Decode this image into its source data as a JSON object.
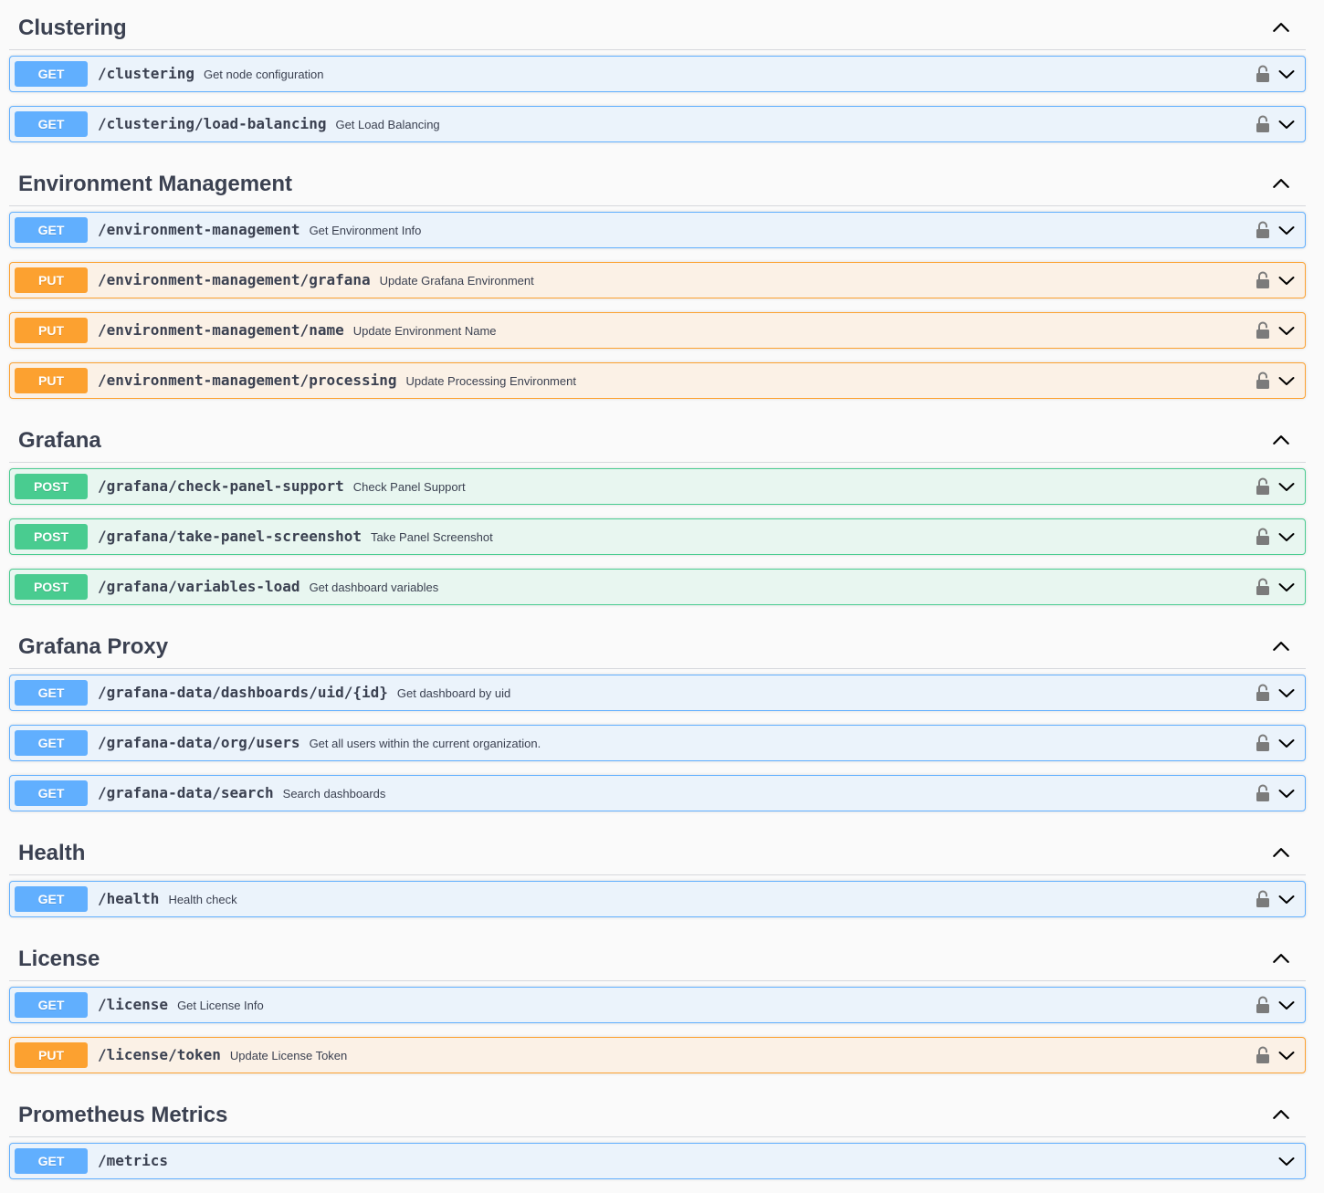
{
  "colors": {
    "get": {
      "badge": "#61affe",
      "bg": "#ebf3fb",
      "border": "#61affe"
    },
    "put": {
      "badge": "#fca130",
      "bg": "#fbf1e6",
      "border": "#fca130"
    },
    "post": {
      "badge": "#49cc90",
      "bg": "#e8f6f0",
      "border": "#49cc90"
    }
  },
  "icons": {
    "section_toggle": "chevron-up-icon",
    "operation_expand": "chevron-down-icon",
    "auth": "lock-icon"
  },
  "sections": [
    {
      "title": "Clustering",
      "operations": [
        {
          "method": "GET",
          "path": "/clustering",
          "summary": "Get node configuration",
          "locked": true
        },
        {
          "method": "GET",
          "path": "/clustering/load-balancing",
          "summary": "Get Load Balancing",
          "locked": true
        }
      ]
    },
    {
      "title": "Environment Management",
      "operations": [
        {
          "method": "GET",
          "path": "/environment-management",
          "summary": "Get Environment Info",
          "locked": true
        },
        {
          "method": "PUT",
          "path": "/environment-management/grafana",
          "summary": "Update Grafana Environment",
          "locked": true
        },
        {
          "method": "PUT",
          "path": "/environment-management/name",
          "summary": "Update Environment Name",
          "locked": true
        },
        {
          "method": "PUT",
          "path": "/environment-management/processing",
          "summary": "Update Processing Environment",
          "locked": true
        }
      ]
    },
    {
      "title": "Grafana",
      "operations": [
        {
          "method": "POST",
          "path": "/grafana/check-panel-support",
          "summary": "Check Panel Support",
          "locked": true
        },
        {
          "method": "POST",
          "path": "/grafana/take-panel-screenshot",
          "summary": "Take Panel Screenshot",
          "locked": true
        },
        {
          "method": "POST",
          "path": "/grafana/variables-load",
          "summary": "Get dashboard variables",
          "locked": true
        }
      ]
    },
    {
      "title": "Grafana Proxy",
      "operations": [
        {
          "method": "GET",
          "path": "/grafana-data/dashboards/uid/{id}",
          "summary": "Get dashboard by uid",
          "locked": true
        },
        {
          "method": "GET",
          "path": "/grafana-data/org/users",
          "summary": "Get all users within the current organization.",
          "locked": true
        },
        {
          "method": "GET",
          "path": "/grafana-data/search",
          "summary": "Search dashboards",
          "locked": true
        }
      ]
    },
    {
      "title": "Health",
      "operations": [
        {
          "method": "GET",
          "path": "/health",
          "summary": "Health check",
          "locked": true
        }
      ]
    },
    {
      "title": "License",
      "operations": [
        {
          "method": "GET",
          "path": "/license",
          "summary": "Get License Info",
          "locked": true
        },
        {
          "method": "PUT",
          "path": "/license/token",
          "summary": "Update License Token",
          "locked": true
        }
      ]
    },
    {
      "title": "Prometheus Metrics",
      "operations": [
        {
          "method": "GET",
          "path": "/metrics",
          "summary": "",
          "locked": false
        }
      ]
    }
  ]
}
